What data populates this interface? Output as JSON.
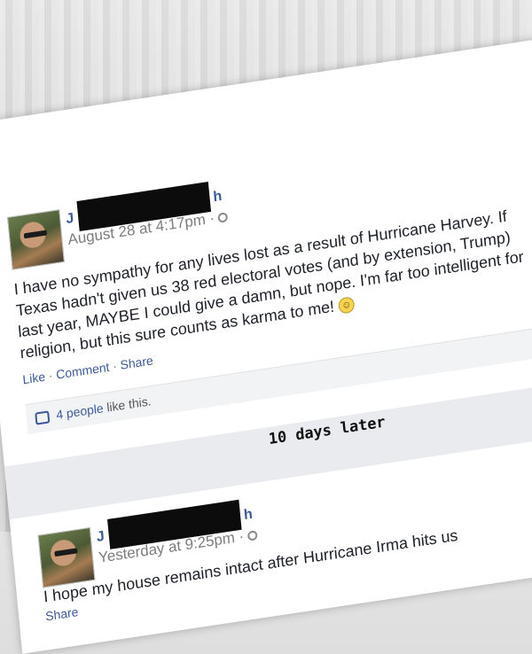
{
  "post1": {
    "name_initial": "J",
    "name_suffix": "h",
    "timestamp": "August 28 at 4:17pm ·",
    "body_lines": [
      "I have no sympathy for any lives lost as a result of Hurricane Harvey. If",
      "Texas hadn't given us 38 red electoral votes (and by extension, Trump)",
      "last year, MAYBE I could give a damn, but nope. I'm far too intelligent for",
      "religion, but this sure counts as karma to me!"
    ],
    "actions": {
      "like": "Like",
      "comment": "Comment",
      "share": "Share"
    },
    "likes": {
      "count_link": "4 people",
      "suffix": "like this."
    }
  },
  "separator": {
    "text": "10 days later"
  },
  "post2": {
    "name_initial": "J",
    "name_suffix": "h",
    "timestamp": "Yesterday at 9:25pm ·",
    "body": "I hope my house remains intact after Hurricane Irma hits us",
    "actions": {
      "share": "Share"
    }
  },
  "colors": {
    "link": "#3b5998",
    "text": "#1d2129",
    "muted": "#7c7c7c"
  }
}
